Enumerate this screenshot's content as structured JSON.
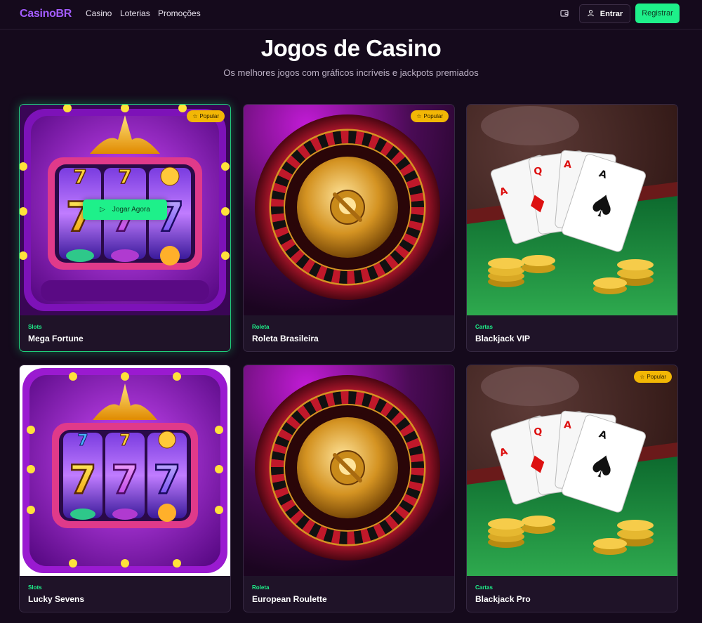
{
  "nav": {
    "logo": "CasinoBR",
    "links": [
      "Casino",
      "Loterias",
      "Promoções"
    ],
    "login_label": "Entrar",
    "register_label": "Registrar",
    "wallet_icon": "wallet-icon",
    "user_icon": "user-icon"
  },
  "header": {
    "title": "Jogos de Casino",
    "subtitle": "Os melhores jogos com gráficos incríveis e jackpots premiados"
  },
  "colors": {
    "background": "#150a1c",
    "brand": "#a35cff",
    "accent": "#1ef08a",
    "badge": "#f2b705"
  },
  "games": [
    {
      "category": "Slots",
      "name": "Mega Fortune",
      "badge": "Popular",
      "play_label": "Jogar Agora",
      "art": "slot-machine-image"
    },
    {
      "category": "Roleta",
      "name": "Roleta Brasileira",
      "badge": "Popular",
      "art": "roulette-wheel-image"
    },
    {
      "category": "Cartas",
      "name": "Blackjack VIP",
      "badge": "",
      "art": "blackjack-cards-image"
    },
    {
      "category": "Slots",
      "name": "Lucky Sevens",
      "badge": "",
      "art": "slot-machine-image"
    },
    {
      "category": "Roleta",
      "name": "European Roulette",
      "badge": "",
      "art": "roulette-wheel-image"
    },
    {
      "category": "Cartas",
      "name": "Blackjack Pro",
      "badge": "Popular",
      "art": "blackjack-cards-image"
    }
  ]
}
